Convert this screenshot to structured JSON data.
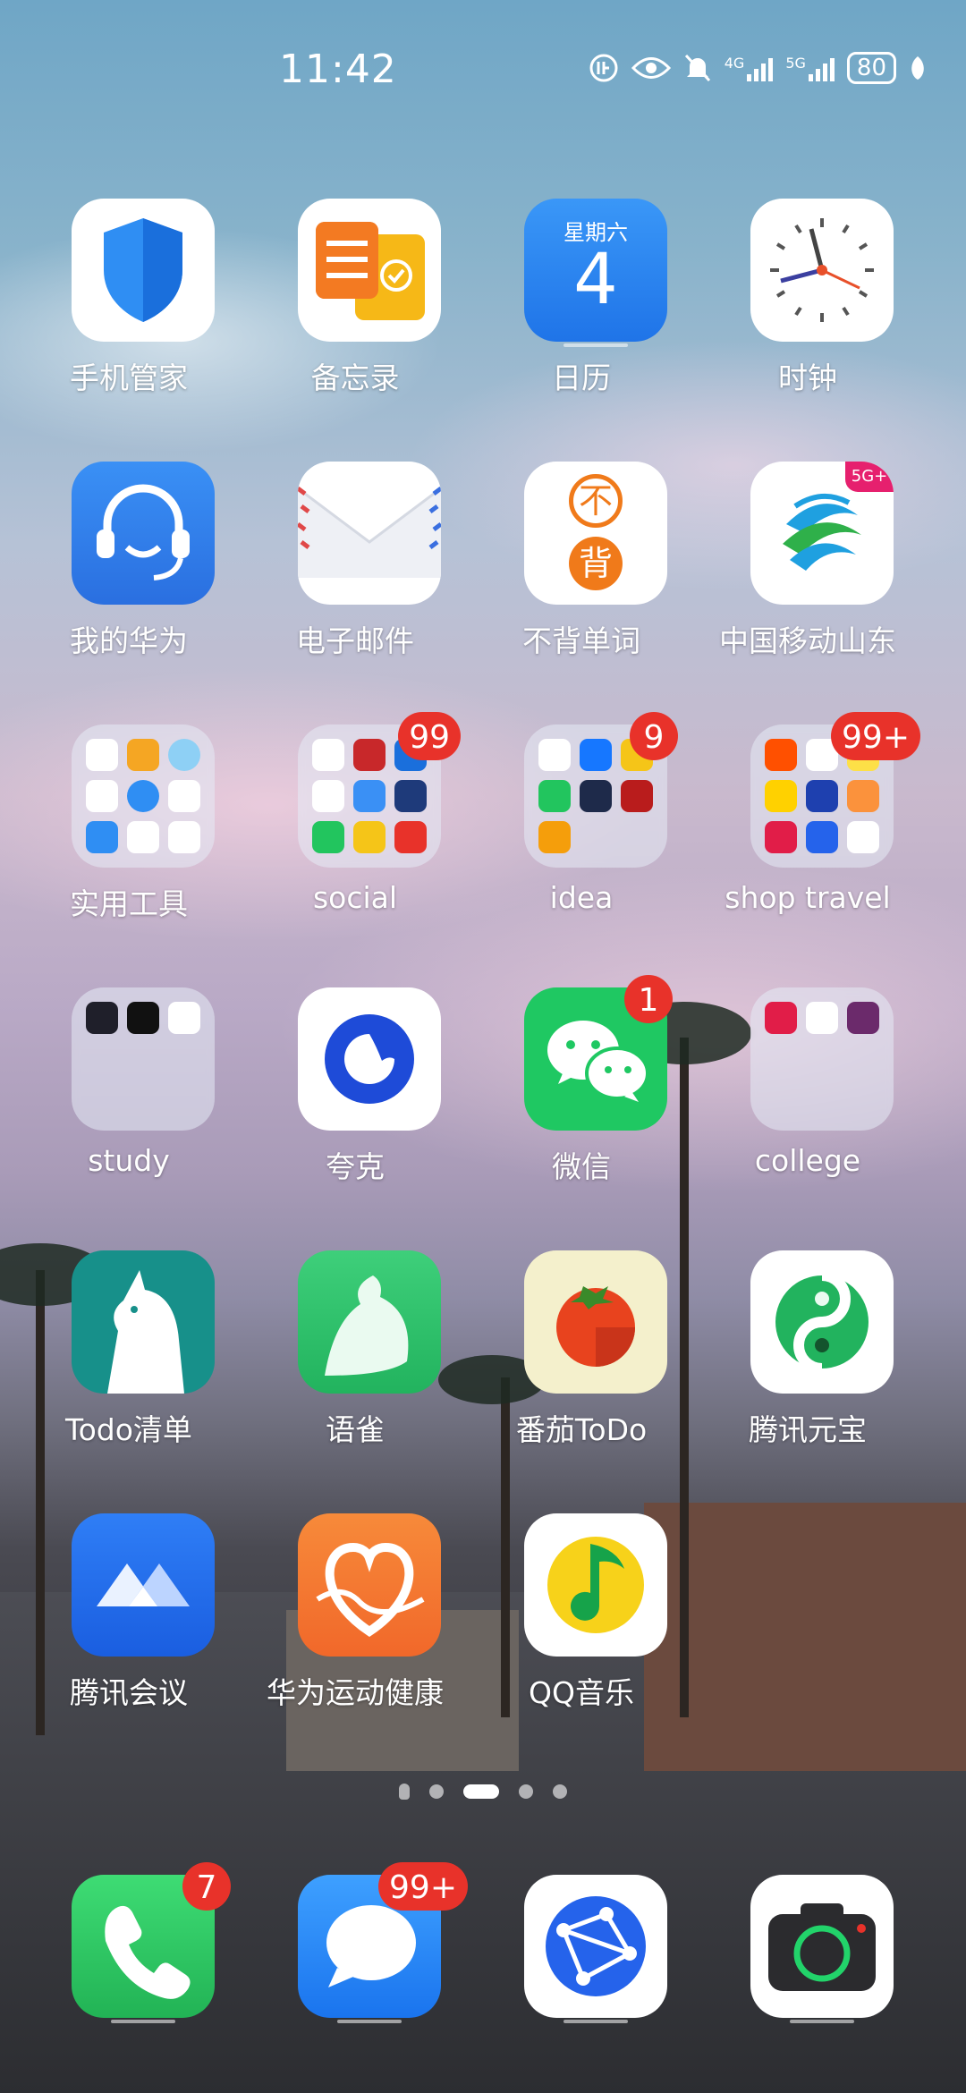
{
  "status_bar": {
    "time": "11:42",
    "network_1": "4G",
    "network_2": "5G",
    "battery": "80"
  },
  "apps": [
    {
      "label": "手机管家"
    },
    {
      "label": "备忘录"
    },
    {
      "label": "日历",
      "weekday": "星期六",
      "date": "4"
    },
    {
      "label": "时钟"
    },
    {
      "label": "我的华为"
    },
    {
      "label": "电子邮件"
    },
    {
      "label": "不背单词",
      "glyph_top": "不",
      "glyph_bottom": "背"
    },
    {
      "label": "中国移动山东",
      "tag": "5G+"
    },
    {
      "label": "实用工具"
    },
    {
      "label": "social",
      "badge": "99"
    },
    {
      "label": "idea",
      "badge": "9"
    },
    {
      "label": "shop  travel",
      "badge": "99+"
    },
    {
      "label": "study"
    },
    {
      "label": "夸克"
    },
    {
      "label": "微信",
      "badge": "1"
    },
    {
      "label": "college"
    },
    {
      "label": "Todo清单"
    },
    {
      "label": "语雀"
    },
    {
      "label": "番茄ToDo"
    },
    {
      "label": "腾讯元宝"
    },
    {
      "label": "腾讯会议"
    },
    {
      "label": "华为运动健康"
    },
    {
      "label": "QQ音乐"
    }
  ],
  "dock": [
    {
      "name": "phone",
      "badge": "7"
    },
    {
      "name": "messages",
      "badge": "99+"
    },
    {
      "name": "browser"
    },
    {
      "name": "camera"
    }
  ],
  "pager": {
    "pages": 4,
    "active": 1
  }
}
